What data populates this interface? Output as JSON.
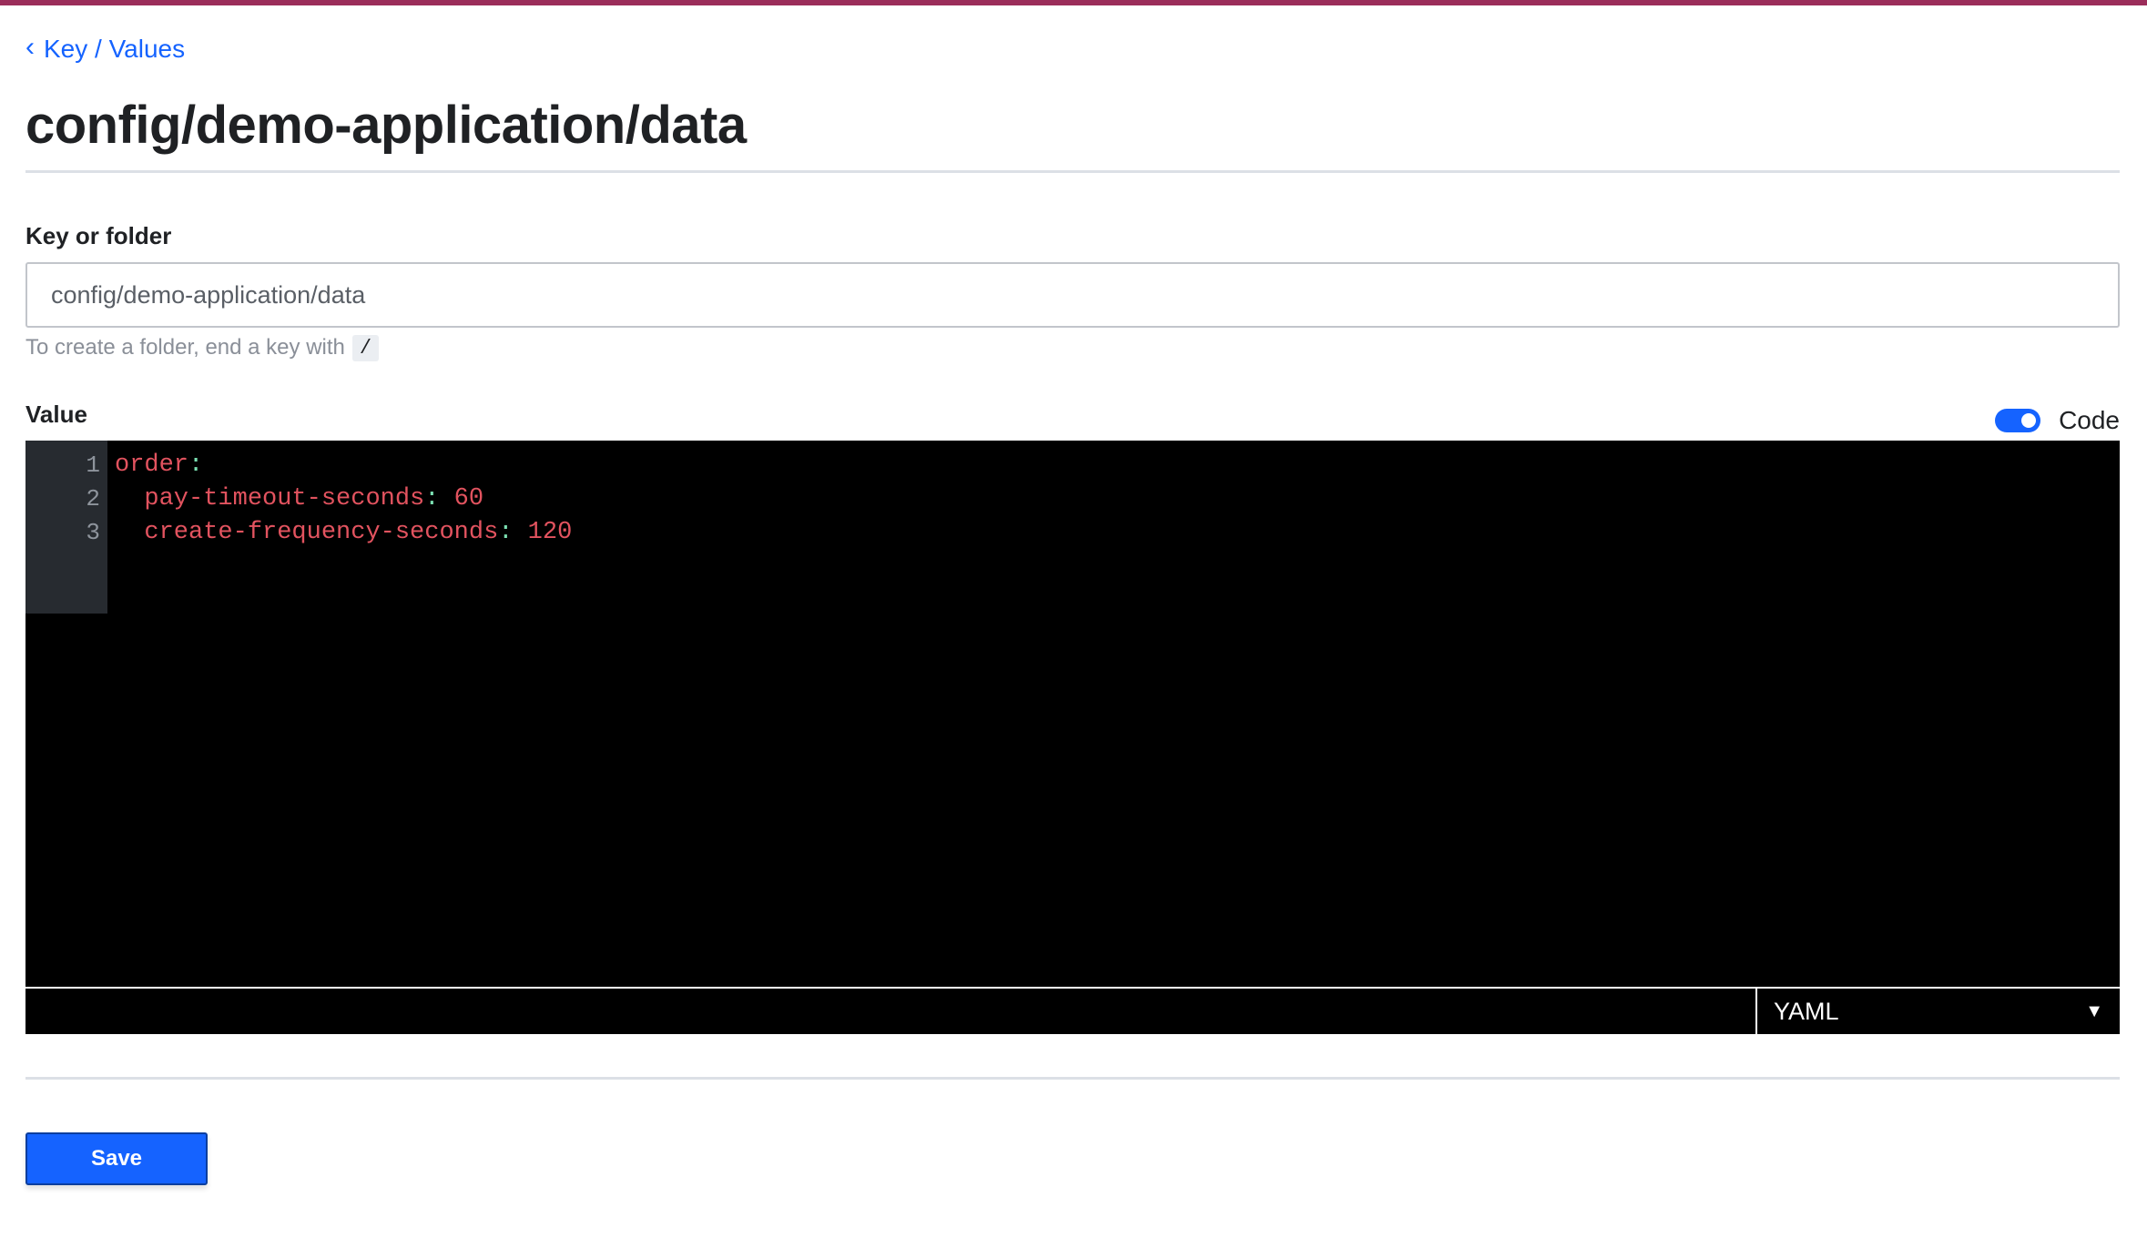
{
  "breadcrumb": {
    "label": "Key / Values"
  },
  "page": {
    "title": "config/demo-application/data"
  },
  "key_field": {
    "label": "Key or folder",
    "value": "config/demo-application/data",
    "help_text": "To create a folder, end a key with",
    "help_code": "/"
  },
  "value_field": {
    "label": "Value",
    "code_toggle_label": "Code",
    "code_toggle_on": true
  },
  "editor": {
    "lines": [
      {
        "number": "1",
        "indent": "",
        "key": "order",
        "colon": ":",
        "value": ""
      },
      {
        "number": "2",
        "indent": "  ",
        "key": "pay-timeout-seconds",
        "colon": ":",
        "value": " 60"
      },
      {
        "number": "3",
        "indent": "  ",
        "key": "create-frequency-seconds",
        "colon": ":",
        "value": " 120"
      }
    ],
    "syntax_mode": "YAML",
    "colors": {
      "key": "#e2535f",
      "punctuation": "#7be0b2",
      "background": "#000000",
      "gutter": "#272b30"
    }
  },
  "actions": {
    "save_label": "Save"
  },
  "colors": {
    "accent": "#1563ff",
    "brand_bar": "#9b2d5a"
  }
}
